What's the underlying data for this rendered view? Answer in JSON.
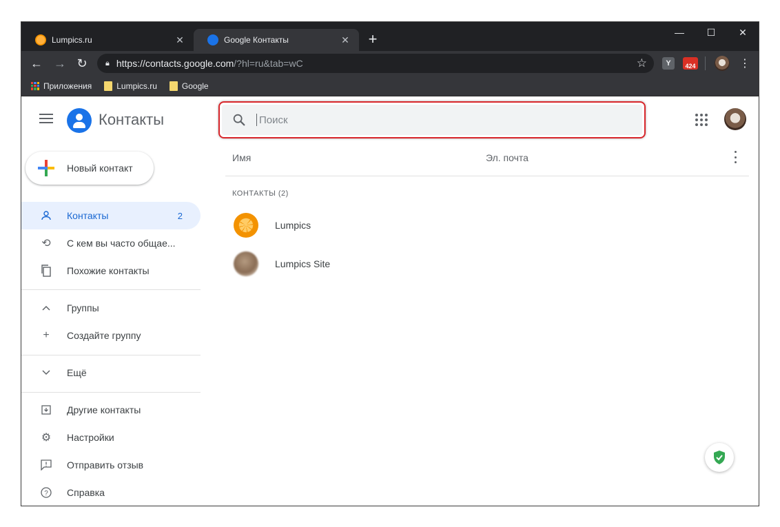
{
  "browser": {
    "tabs": [
      {
        "title": "Lumpics.ru",
        "favicon": "lumpics-orange-icon"
      },
      {
        "title": "Google Контакты",
        "favicon": "google-contacts-icon"
      }
    ],
    "url_main": "https://contacts.google.com",
    "url_rest": "/?hl=ru&tab=wC",
    "extension_badge": "424",
    "extension_y_label": "Y",
    "bookmarks": [
      {
        "label": "Приложения",
        "icon": "apps-grid-icon"
      },
      {
        "label": "Lumpics.ru",
        "icon": "folder-icon"
      },
      {
        "label": "Google",
        "icon": "folder-icon"
      }
    ]
  },
  "app": {
    "title": "Контакты",
    "search_placeholder": "Поиск",
    "new_contact_label": "Новый контакт",
    "sidebar": [
      {
        "label": "Контакты",
        "count": "2",
        "icon": "person-icon",
        "active": true
      },
      {
        "label": "С кем вы часто общае...",
        "icon": "history-icon"
      },
      {
        "label": "Похожие контакты",
        "icon": "copy-icon"
      },
      {
        "label": "Группы",
        "icon": "chevron-up-icon"
      },
      {
        "label": "Создайте группу",
        "icon": "plus-icon"
      },
      {
        "label": "Ещё",
        "icon": "chevron-down-icon"
      },
      {
        "label": "Другие контакты",
        "icon": "archive-icon"
      },
      {
        "label": "Настройки",
        "icon": "gear-icon"
      },
      {
        "label": "Отправить отзыв",
        "icon": "feedback-icon"
      },
      {
        "label": "Справка",
        "icon": "help-icon"
      }
    ],
    "columns": {
      "name": "Имя",
      "email": "Эл. почта"
    },
    "section_label": "КОНТАКТЫ (2)",
    "contacts": [
      {
        "name": "Lumpics",
        "avatar": "orange-avatar"
      },
      {
        "name": "Lumpics Site",
        "avatar": "blurred-photo-avatar"
      }
    ]
  },
  "colors": {
    "accent_blue": "#1a73e8",
    "highlight_red": "#d8262b",
    "active_bg": "#e8f0fe",
    "chrome_dark": "#202124"
  }
}
